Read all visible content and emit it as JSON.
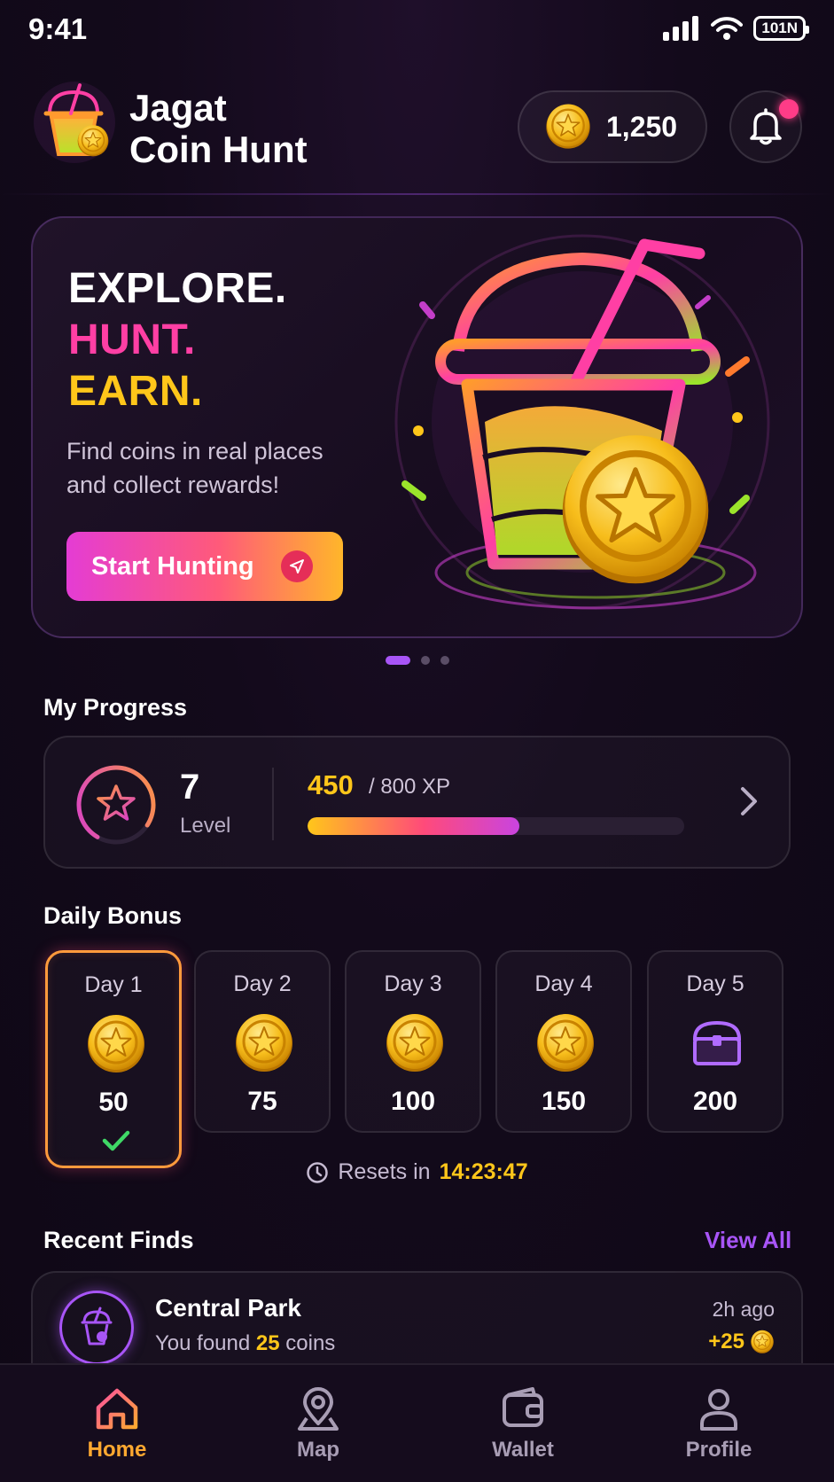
{
  "status_bar": {
    "time": "9:41",
    "battery": "101N"
  },
  "header": {
    "title_line1": "Jagat",
    "title_line2": "Coin Hunt",
    "coin_balance": "1,250"
  },
  "hero": {
    "line1": "EXPLORE.",
    "line2": "HUNT.",
    "line3": "EARN.",
    "subtitle": "Find coins in real places and collect rewards!",
    "cta_label": "Start Hunting",
    "carousel_pages": 3,
    "carousel_active": 0
  },
  "progress": {
    "title": "My Progress",
    "level": "7",
    "level_label": "Level",
    "xp_current": "450",
    "xp_total": "/ 800 XP",
    "xp_fraction": 0.5625
  },
  "daily_bonus": {
    "title": "Daily Bonus",
    "days": [
      {
        "label": "Day 1",
        "amount": "50",
        "icon": "coin-icon",
        "claimed": true
      },
      {
        "label": "Day 2",
        "amount": "75",
        "icon": "coin-icon",
        "claimed": false
      },
      {
        "label": "Day 3",
        "amount": "100",
        "icon": "coin-icon",
        "claimed": false
      },
      {
        "label": "Day 4",
        "amount": "150",
        "icon": "coin-icon",
        "claimed": false
      },
      {
        "label": "Day 5",
        "amount": "200",
        "icon": "chest-icon",
        "claimed": false
      }
    ],
    "resets_label": "Resets in",
    "resets_time": "14:23:47"
  },
  "recent_finds": {
    "title": "Recent Finds",
    "view_all": "View All",
    "items": [
      {
        "place": "Central Park",
        "prefix": "You found",
        "amount": "25",
        "suffix": "coins",
        "time": "2h ago",
        "reward": "+25"
      }
    ]
  },
  "tabs": [
    {
      "label": "Home",
      "icon": "home-icon",
      "active": true
    },
    {
      "label": "Map",
      "icon": "map-pin-icon",
      "active": false
    },
    {
      "label": "Wallet",
      "icon": "wallet-icon",
      "active": false
    },
    {
      "label": "Profile",
      "icon": "profile-icon",
      "active": false
    }
  ],
  "colors": {
    "accent_purple": "#a855f7",
    "accent_pink": "#ff3fa4",
    "accent_yellow": "#ffc61a",
    "accent_orange": "#ffa930",
    "background": "#130a1b"
  }
}
